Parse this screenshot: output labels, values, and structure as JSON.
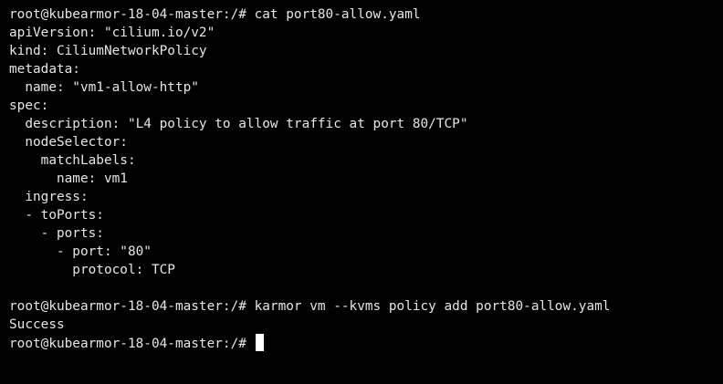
{
  "terminal": {
    "colors": {
      "background": "#000000",
      "text": "#e6e6e6",
      "cursor": "#ffffff"
    },
    "lines": [
      "root@kubearmor-18-04-master:/# cat port80-allow.yaml",
      "apiVersion: \"cilium.io/v2\"",
      "kind: CiliumNetworkPolicy",
      "metadata:",
      "  name: \"vm1-allow-http\"",
      "spec:",
      "  description: \"L4 policy to allow traffic at port 80/TCP\"",
      "  nodeSelector:",
      "    matchLabels:",
      "      name: vm1",
      "  ingress:",
      "  - toPorts:",
      "    - ports:",
      "      - port: \"80\"",
      "        protocol: TCP",
      "",
      "root@kubearmor-18-04-master:/# karmor vm --kvms policy add port80-allow.yaml",
      "Success"
    ],
    "prompt": "root@kubearmor-18-04-master:/# "
  }
}
